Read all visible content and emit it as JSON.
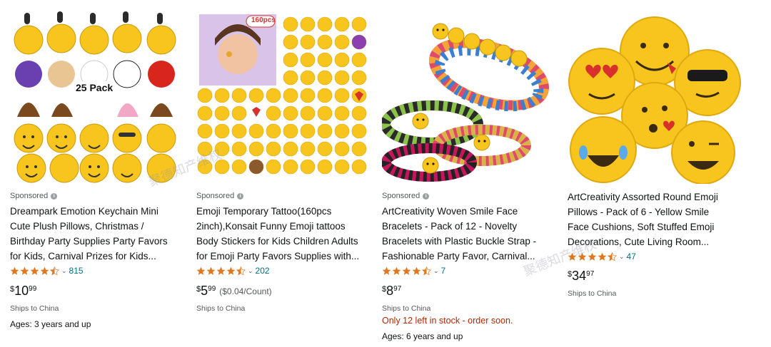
{
  "products": [
    {
      "sponsored_label": "Sponsored",
      "title_lines": [
        "Dreampark Emotion Keychain Mini",
        "Cute Plush Pillows, Christmas /",
        "Birthday Party Supplies Party Favors",
        "for Kids, Carnival Prizes for Kids..."
      ],
      "rating_value": 4.5,
      "rating_count": "815",
      "price_symbol": "$",
      "price_whole": "10",
      "price_fraction": "99",
      "price_unit": "",
      "ships": "Ships to China",
      "stock": "",
      "ages": "Ages: 3 years and up",
      "image_badge": "25 Pack"
    },
    {
      "sponsored_label": "Sponsored",
      "title_lines": [
        "Emoji Temporary Tattoo(160pcs",
        "2inch),Konsait Funny Emoji tattoos",
        "Body Stickers for Kids Children Adults",
        "for Emoji Party Favors Supplies with..."
      ],
      "rating_value": 4.5,
      "rating_count": "202",
      "price_symbol": "$",
      "price_whole": "5",
      "price_fraction": "99",
      "price_unit": "($0.04/Count)",
      "ships": "Ships to China",
      "stock": "",
      "ages": "",
      "image_badge": "160pcs"
    },
    {
      "sponsored_label": "Sponsored",
      "title_lines": [
        "ArtCreativity Woven Smile Face",
        "Bracelets - Pack of 12 - Novelty",
        "Bracelets with Plastic Buckle Strap -",
        "Fashionable Party Favor, Carnival..."
      ],
      "rating_value": 4.5,
      "rating_count": "7",
      "price_symbol": "$",
      "price_whole": "8",
      "price_fraction": "97",
      "price_unit": "",
      "ships": "Ships to China",
      "stock": "Only 12 left in stock - order soon.",
      "ages": "Ages: 6 years and up",
      "image_badge": ""
    },
    {
      "sponsored_label": "",
      "title_lines": [
        "ArtCreativity Assorted Round Emoji",
        "Pillows - Pack of 6 - Yellow Smile",
        "Face Cushions, Soft Stuffed Emoji",
        "Decorations, Cute Living Room..."
      ],
      "rating_value": 4.5,
      "rating_count": "47",
      "price_symbol": "$",
      "price_whole": "34",
      "price_fraction": "97",
      "price_unit": "",
      "ships": "Ships to China",
      "stock": "",
      "ages": "",
      "image_badge": ""
    }
  ],
  "watermark": "聚德知产维权",
  "colors": {
    "star": "#de7921",
    "link": "#007185",
    "stock": "#b12704",
    "emoji": "#f7c51e"
  },
  "icons": [
    "info-icon",
    "star-icon",
    "chevron-down-icon"
  ]
}
